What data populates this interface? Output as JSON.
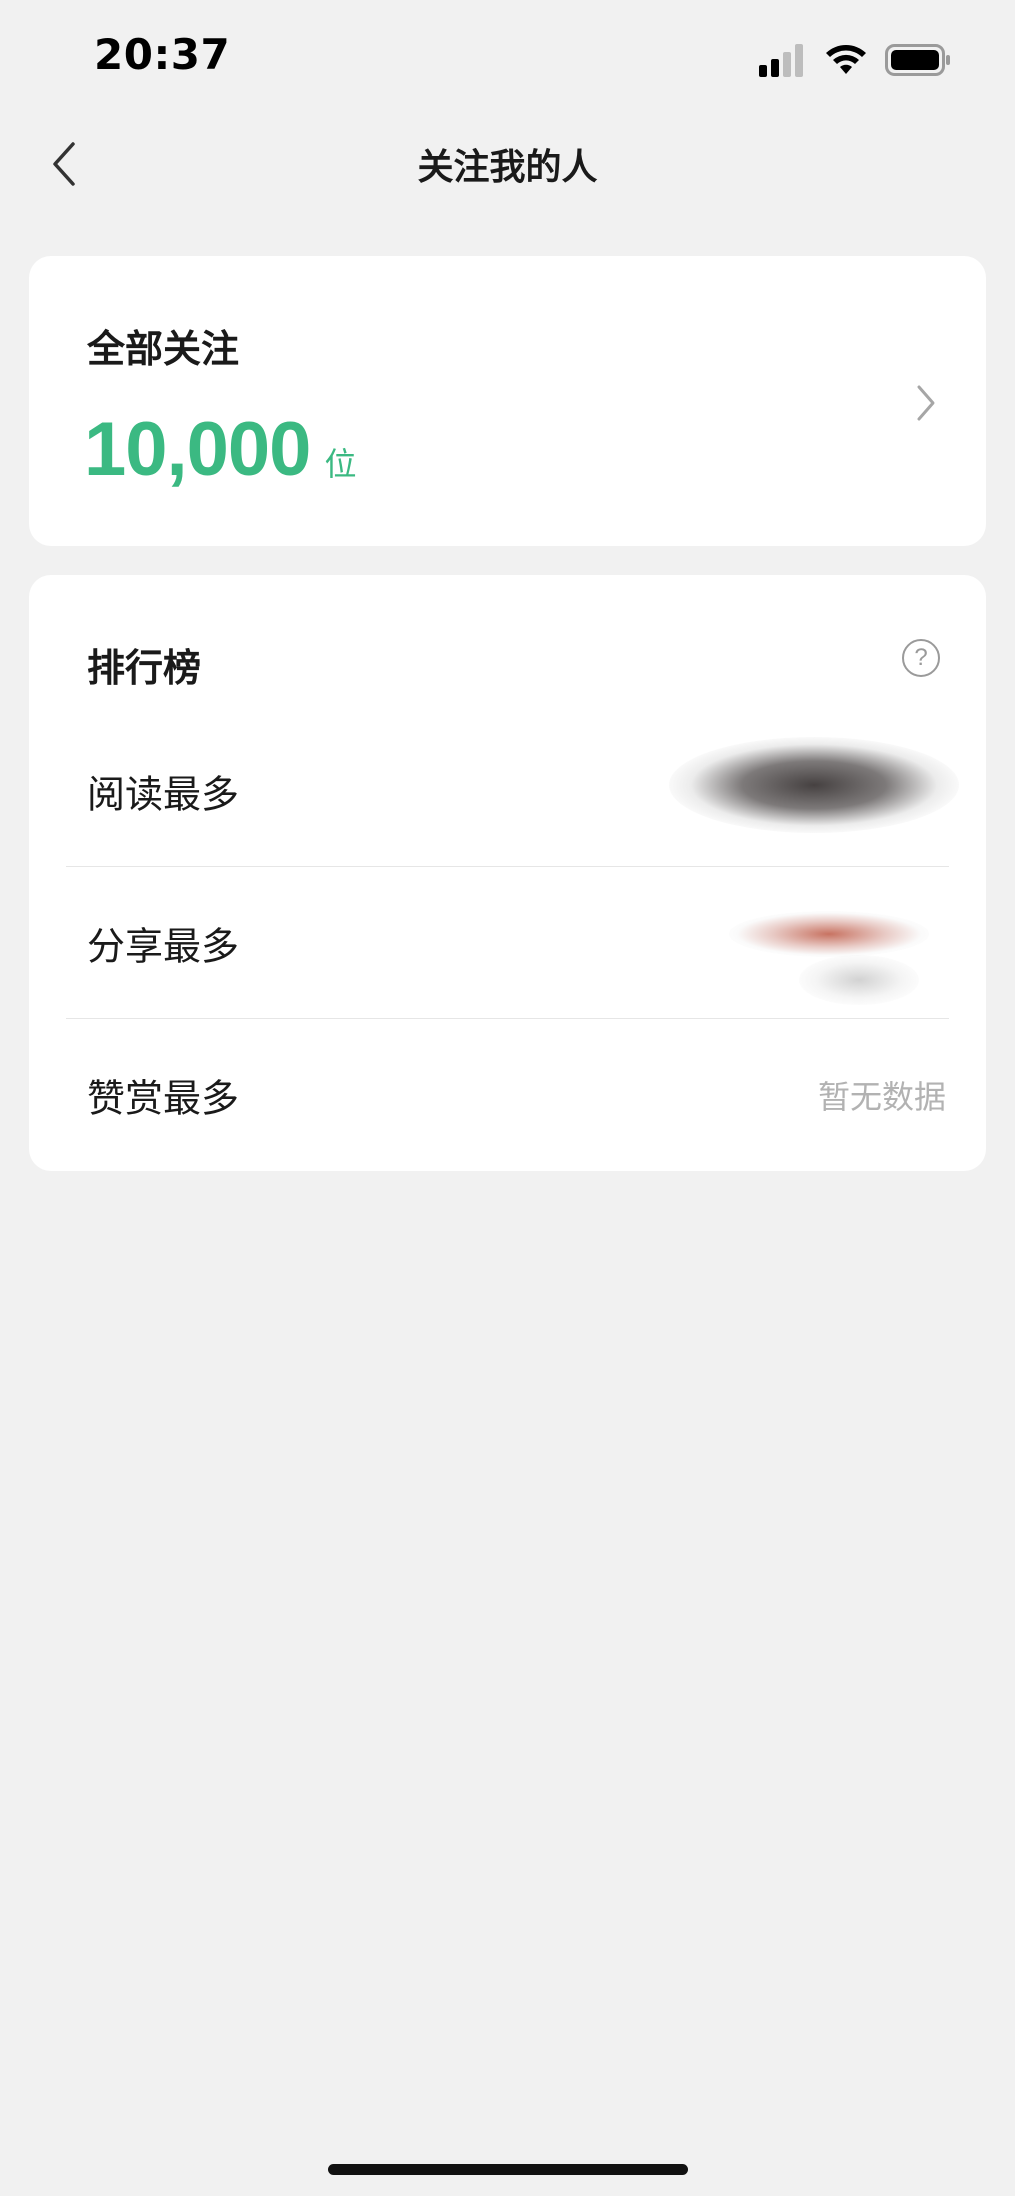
{
  "status_bar": {
    "time": "20:37",
    "icons": [
      "cellular-signal-icon",
      "wifi-icon",
      "battery-icon"
    ]
  },
  "nav": {
    "title": "关注我的人",
    "back_icon": "chevron-left-icon"
  },
  "total_card": {
    "label": "全部关注",
    "count": "10,000",
    "unit": "位",
    "chevron_icon": "chevron-right-icon"
  },
  "ranking": {
    "title": "排行榜",
    "help_icon": "question-circle-icon",
    "help_glyph": "?",
    "rows": [
      {
        "label": "阅读最多",
        "value": ""
      },
      {
        "label": "分享最多",
        "value": ""
      },
      {
        "label": "赞赏最多",
        "value": "暂无数据"
      }
    ]
  },
  "colors": {
    "accent": "#3bb982",
    "background": "#f1f1f1",
    "card": "#ffffff",
    "muted_text": "#b2b2b2"
  }
}
